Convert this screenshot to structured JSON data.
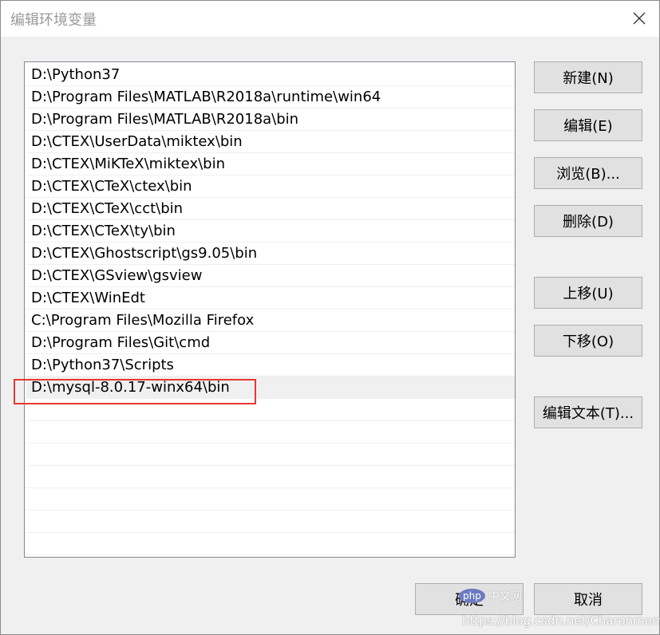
{
  "window": {
    "title": "编辑环境变量",
    "close_icon": "close-icon"
  },
  "path_list": {
    "items": [
      "D:\\Python37",
      "D:\\Program Files\\MATLAB\\R2018a\\runtime\\win64",
      "D:\\Program Files\\MATLAB\\R2018a\\bin",
      "D:\\CTEX\\UserData\\miktex\\bin",
      "D:\\CTEX\\MiKTeX\\miktex\\bin",
      "D:\\CTEX\\CTeX\\ctex\\bin",
      "D:\\CTEX\\CTeX\\cct\\bin",
      "D:\\CTEX\\CTeX\\ty\\bin",
      "D:\\CTEX\\Ghostscript\\gs9.05\\bin",
      "D:\\CTEX\\GSview\\gsview",
      "D:\\CTEX\\WinEdt",
      "C:\\Program Files\\Mozilla Firefox",
      "D:\\Program Files\\Git\\cmd",
      "D:\\Python37\\Scripts",
      "D:\\mysql-8.0.17-winx64\\bin"
    ],
    "selected": "D:\\mysql-8.0.17-winx64\\bin",
    "highlight_color": "#e53935"
  },
  "buttons": {
    "new": "新建(N)",
    "edit": "编辑(E)",
    "browse": "浏览(B)...",
    "delete": "删除(D)",
    "move_up": "上移(U)",
    "move_down": "下移(O)",
    "edit_text": "编辑文本(T)...",
    "ok": "确定",
    "cancel": "取消"
  },
  "watermark": {
    "logo": "php",
    "label": "中文网",
    "url": "https://blog.csdn.net/Charonmomo"
  }
}
